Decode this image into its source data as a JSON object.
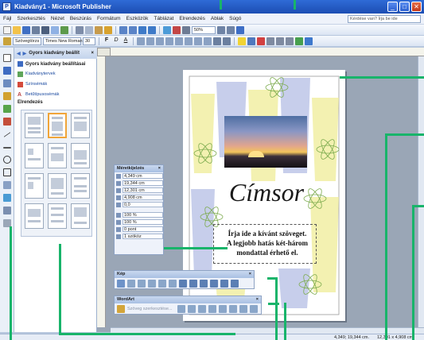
{
  "window": {
    "title": "Kiadvány1 - Microsoft Publisher",
    "minimize": "_",
    "maximize": "□",
    "close": "✕"
  },
  "menu": [
    "Fájl",
    "Szerkesztés",
    "Nézet",
    "Beszúrás",
    "Formátum",
    "Eszközök",
    "Táblázat",
    "Elrendezés",
    "Ablak",
    "Súgó"
  ],
  "help_placeholder": "Kérdése van? Írja be ide",
  "toolbar2": {
    "style": "Szövegtörzs",
    "font": "Times New Roman",
    "size": "30",
    "bold": "F",
    "italic": "D",
    "underline": "A"
  },
  "zoom": "50%",
  "taskpane": {
    "nav": "Gyors kiadvány beállít",
    "close": "×",
    "section": "Gyors kiadvány beállításai",
    "links": [
      "Kiadványtervek",
      "Színsémák",
      "Betűtípusosémák"
    ],
    "layout_label": "Elrendezés"
  },
  "measurements": {
    "title": "Méretkijelzés",
    "rows": [
      "4,349 cm",
      "19,344 cm",
      "12,301 cm",
      "4,908 cm",
      "0,0",
      "100 %",
      "100 %",
      "0 pont",
      "1 szóköz"
    ]
  },
  "picture_palette": {
    "title": "Kép"
  },
  "wordart_palette": {
    "title": "WordArt",
    "label": "Szöveg szerkesztése..."
  },
  "page": {
    "heading": "Címsor",
    "body": [
      "Írja ide a kívánt szöveget.",
      "A legjobb hatás két-három",
      "mondattal érhető el."
    ]
  },
  "status": {
    "position": "4,349; 19,344 cm.",
    "size": "12,301 x 4,908 cm."
  },
  "colors": {
    "title_blue": "#1c4db3",
    "callout": "#18b46a",
    "shape_yellow": "#f0ee9e",
    "shape_blue": "#b9c2e6",
    "atom_green": "#7cab4e"
  }
}
